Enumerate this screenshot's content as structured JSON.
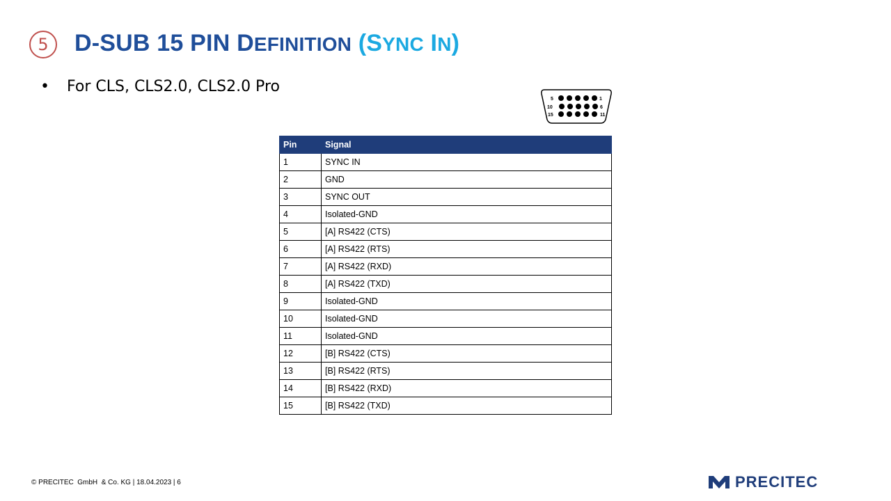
{
  "header": {
    "step_number": "5",
    "title_main": "D-SUB 15 PIN D",
    "title_sc": "efinition",
    "title_accent_open": "(S",
    "title_accent_sc1": "ync",
    "title_accent_mid": " I",
    "title_accent_sc2": "n",
    "title_accent_close": ")"
  },
  "bullet": {
    "symbol": "•",
    "text": "For CLS, CLS2.0, CLS2.0 Pro"
  },
  "connector": {
    "icon": "d-sub-15-connector-icon",
    "labels": {
      "top_left": "5",
      "top_right": "1",
      "mid_left": "10",
      "mid_right": "6",
      "bottom_left": "15",
      "bottom_right": "11"
    }
  },
  "table": {
    "headers": {
      "pin": "Pin",
      "signal": "Signal"
    },
    "rows": [
      {
        "pin": "1",
        "signal": "SYNC IN"
      },
      {
        "pin": "2",
        "signal": "GND"
      },
      {
        "pin": "3",
        "signal": "SYNC OUT"
      },
      {
        "pin": "4",
        "signal": "Isolated-GND"
      },
      {
        "pin": "5",
        "signal": "[A] RS422 (CTS)"
      },
      {
        "pin": "6",
        "signal": "[A] RS422 (RTS)"
      },
      {
        "pin": "7",
        "signal": "[A] RS422 (RXD)"
      },
      {
        "pin": "8",
        "signal": "[A] RS422 (TXD)"
      },
      {
        "pin": "9",
        "signal": "Isolated-GND"
      },
      {
        "pin": "10",
        "signal": "Isolated-GND"
      },
      {
        "pin": "11",
        "signal": "Isolated-GND"
      },
      {
        "pin": "12",
        "signal": "[B] RS422 (CTS)"
      },
      {
        "pin": "13",
        "signal": "[B] RS422 (RTS)"
      },
      {
        "pin": "14",
        "signal": "[B] RS422 (RXD)"
      },
      {
        "pin": "15",
        "signal": "[B] RS422 (TXD)"
      }
    ]
  },
  "footer": {
    "text": "© PRECITEC  GmbH  & Co. KG | 18.04.2023 | 6"
  },
  "logo": {
    "icon": "precitec-logo-icon",
    "text": "PRECITEC"
  },
  "colors": {
    "title": "#1f4e9a",
    "accent": "#1ba9e1",
    "badge": "#c0504d",
    "table_header": "#1f3d7a"
  }
}
